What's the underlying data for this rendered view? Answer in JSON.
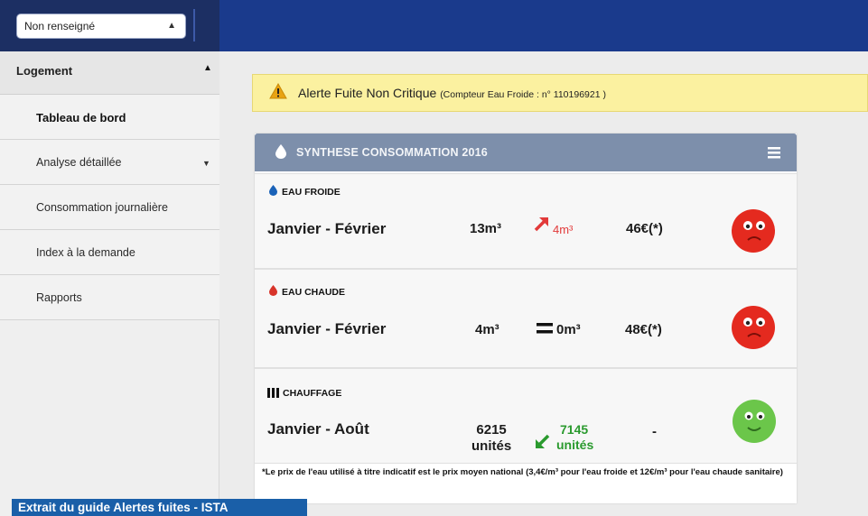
{
  "header": {
    "select_value": "Non renseigné"
  },
  "sidebar": {
    "section_label": "Logement",
    "items": [
      {
        "label": "Tableau de bord"
      },
      {
        "label": "Analyse détaillée"
      },
      {
        "label": "Consommation journalière"
      },
      {
        "label": "Index à la demande"
      },
      {
        "label": "Rapports"
      }
    ]
  },
  "alert": {
    "title": "Alerte Fuite Non Critique",
    "detail": "(Compteur Eau Froide : n° 110196921 )"
  },
  "panel": {
    "title": "SYNTHESE CONSOMMATION 2016",
    "rows": [
      {
        "category": "EAU FROIDE",
        "period": "Janvier - Février",
        "value": "13m³",
        "delta": "4m³",
        "cost": "46€(*)"
      },
      {
        "category": "EAU CHAUDE",
        "period": "Janvier - Février",
        "value": "4m³",
        "delta": "0m³",
        "cost": "48€(*)"
      },
      {
        "category": "CHAUFFAGE",
        "period": "Janvier - Août",
        "value_line1": "6215",
        "value_line2": "unités",
        "delta_line1": "7145",
        "delta_line2": "unités",
        "cost": "-"
      }
    ],
    "footnote": "*Le prix de l'eau utilisé à titre indicatif est le prix moyen national (3,4€/m³ pour l'eau froide et 12€/m³ pour l'eau chaude sanitaire)"
  },
  "caption": "Extrait du guide Alertes fuites - ISTA",
  "colors": {
    "topbar": "#1a3a8c",
    "panel_header": "#7d8fab",
    "alert_bg": "#fbf1a0",
    "increase_red": "#e23a3a",
    "decrease_green": "#2a9a2e",
    "caption_bg": "#1a5fa8"
  }
}
